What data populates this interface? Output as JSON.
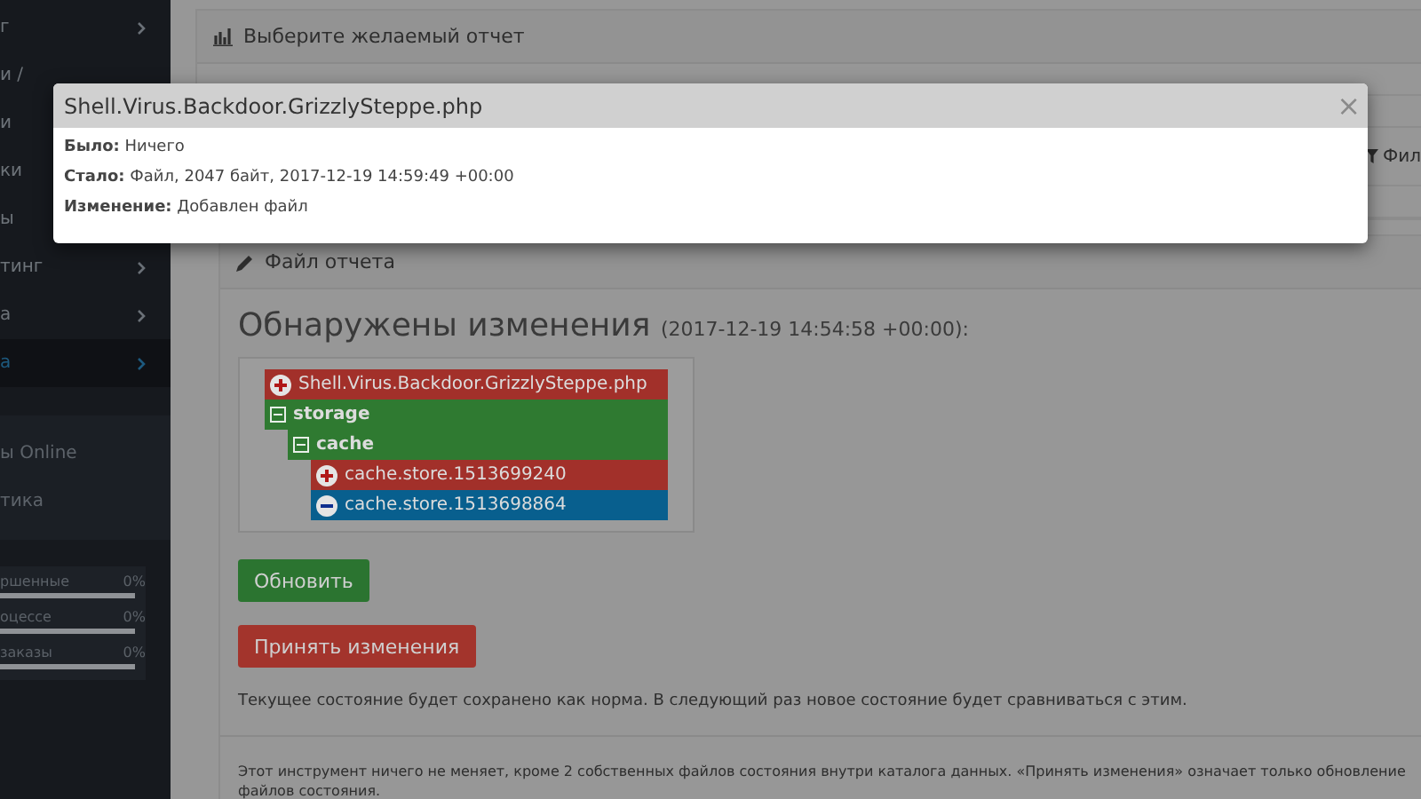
{
  "sidebar": {
    "menu": [
      {
        "label": "г",
        "chevron": true,
        "active": false
      },
      {
        "label": "и /",
        "chevron": false,
        "active": false
      },
      {
        "label": "и",
        "chevron": false,
        "active": false
      },
      {
        "label": "ки",
        "chevron": false,
        "active": false
      },
      {
        "label": "ы",
        "chevron": false,
        "active": false
      },
      {
        "label": "тинг",
        "chevron": true,
        "active": false
      },
      {
        "label": "а",
        "chevron": true,
        "active": false
      },
      {
        "label": "а",
        "chevron": true,
        "active": true
      }
    ],
    "links": [
      {
        "label": "ы Online"
      },
      {
        "label": "тика"
      }
    ],
    "progress": [
      {
        "label": "ршенные",
        "value": "0%",
        "level": 0
      },
      {
        "label": "оцессе",
        "value": "0%",
        "level": 0
      },
      {
        "label": "заказы",
        "value": "0%",
        "level": 0
      }
    ]
  },
  "report_panel": {
    "title": "Выберите желаемый отчет",
    "filter_button": "Фил"
  },
  "file_panel": {
    "title": "Файл отчета",
    "heading": "Обнаружены изменения",
    "timestamp": "(2017-12-19 14:54:58 +00:00):",
    "tree": [
      {
        "label": "Shell.Virus.Backdoor.GrizzlySteppe.php",
        "kind": "added",
        "color": "#a2302a"
      },
      {
        "label": "storage",
        "kind": "folder",
        "color": "#2f7a31",
        "children": [
          {
            "label": "cache",
            "kind": "folder",
            "color": "#2f7a31",
            "children": [
              {
                "label": "cache.store.1513699240",
                "kind": "added",
                "color": "#a2302a"
              },
              {
                "label": "cache.store.1513698864",
                "kind": "removed",
                "color": "#085f8e"
              }
            ]
          }
        ]
      }
    ],
    "refresh_button": "Обновить",
    "accept_button": "Принять изменения",
    "note": "Текущее состояние будет сохранено как норма. В следующий раз новое состояние будет сравниваться с этим.",
    "info": "Этот инструмент ничего не меняет, кроме 2 собственных файлов состояния внутри каталога данных. «Принять изменения» означает только обновление\nфайлов состояния."
  },
  "modal": {
    "title": "Shell.Virus.Backdoor.GrizzlySteppe.php",
    "close": "×",
    "lines": [
      "**Было:** Ничего",
      "**Стало:** Файл, 2047 байт, 2017-12-19 14:59:49 +00:00",
      "**Изменение:** Добавлен файл"
    ]
  }
}
